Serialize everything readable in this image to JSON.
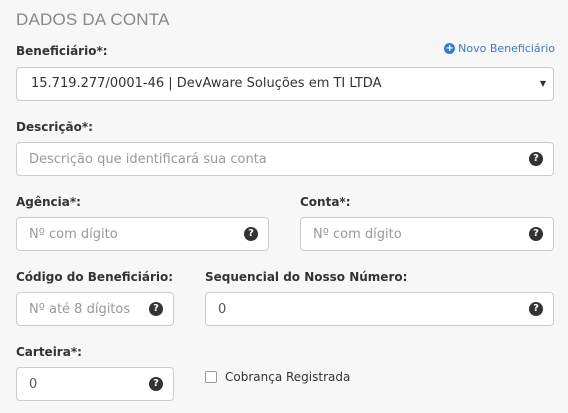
{
  "section": {
    "title": "DADOS DA CONTA"
  },
  "beneficiario": {
    "label": "Beneficiário*:",
    "new_link": "Novo Beneficiário",
    "selected": "15.719.277/0001-46 | DevAware Soluções em TI LTDA"
  },
  "descricao": {
    "label": "Descrição*:",
    "placeholder": "Descrição que identificará sua conta",
    "value": ""
  },
  "agencia": {
    "label": "Agência*:",
    "placeholder": "Nº com dígito",
    "value": ""
  },
  "conta": {
    "label": "Conta*:",
    "placeholder": "Nº com dígito",
    "value": ""
  },
  "codigo_beneficiario": {
    "label": "Código do Beneficiário:",
    "placeholder": "Nº até 8 dígitos",
    "value": ""
  },
  "sequencial": {
    "label": "Sequencial do Nosso Número:",
    "placeholder": "",
    "value": "0"
  },
  "carteira": {
    "label": "Carteira*:",
    "placeholder": "",
    "value": "0"
  },
  "cobranca": {
    "label": "Cobrança Registrada",
    "checked": false
  },
  "icons": {
    "help": "question-circle-icon",
    "plus": "plus-circle-icon",
    "caret": "caret-down-icon"
  },
  "colors": {
    "link": "#3a7bc0",
    "border": "#cccccc",
    "background": "#f7f7f7"
  }
}
